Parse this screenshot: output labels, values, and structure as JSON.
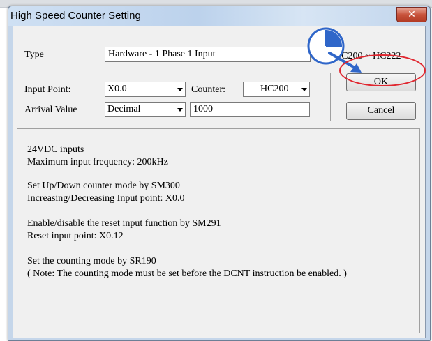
{
  "window": {
    "title": "High Speed Counter Setting",
    "close_glyph": "✕"
  },
  "type": {
    "label": "Type",
    "value": "Hardware - 1 Phase 1 Input",
    "range": "HC200 ~ HC222"
  },
  "input_point": {
    "label": "Input Point:",
    "value": "X0.0"
  },
  "counter": {
    "label": "Counter:",
    "value": "HC200"
  },
  "arrival_value": {
    "label": "Arrival Value",
    "format": "Decimal",
    "value": "1000"
  },
  "buttons": {
    "ok": "OK",
    "cancel": "Cancel"
  },
  "info": [
    "24VDC inputs",
    "Maximum input frequency: 200kHz",
    "Set Up/Down counter mode by SM300",
    "Increasing/Decreasing Input point: X0.0",
    "Enable/disable the reset input function by SM291",
    "Reset input point: X0.12",
    "Set the counting mode by SR190",
    "( Note: The counting mode must be set before the DCNT instruction be enabled. )"
  ],
  "annotation": {
    "clock_icon": "clock-icon",
    "highlight_color": "#e0262f",
    "arrow_color": "#2f66c9"
  }
}
